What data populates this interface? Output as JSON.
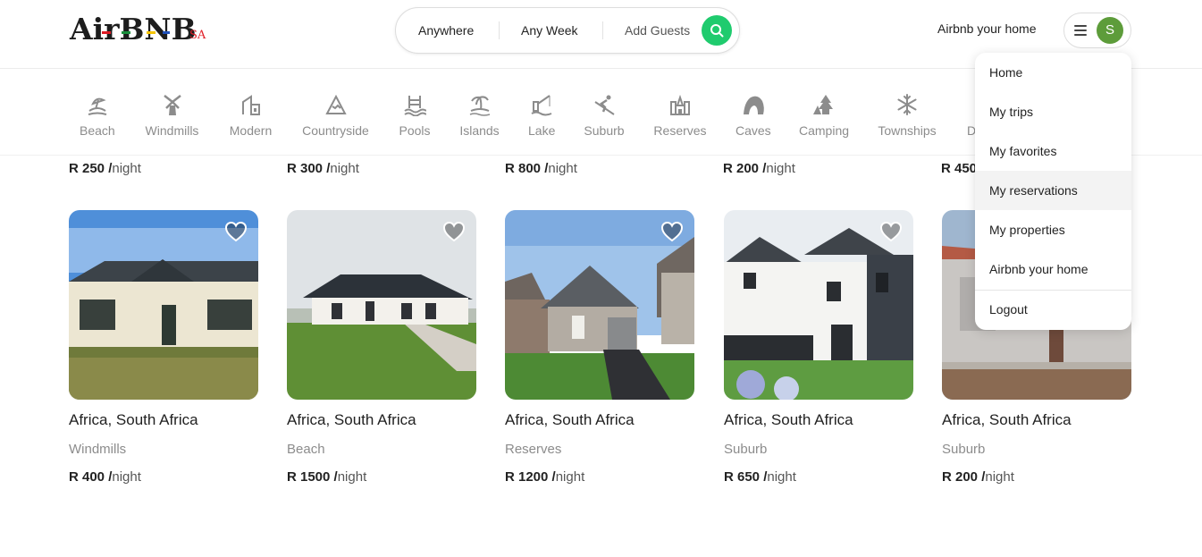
{
  "brand": {
    "name": "AirBNB",
    "suffix": "SA"
  },
  "search": {
    "anywhere": "Anywhere",
    "week": "Any Week",
    "guests": "Add Guests",
    "accent": "#1fcb6e"
  },
  "header": {
    "host_link": "Airbnb your home",
    "avatar_initial": "S",
    "avatar_color": "#5d9c3a"
  },
  "categories": [
    {
      "label": "Beach",
      "icon": "beach-icon"
    },
    {
      "label": "Windmills",
      "icon": "windmill-icon"
    },
    {
      "label": "Modern",
      "icon": "modern-icon"
    },
    {
      "label": "Countryside",
      "icon": "mountain-icon"
    },
    {
      "label": "Pools",
      "icon": "pool-icon"
    },
    {
      "label": "Islands",
      "icon": "island-icon"
    },
    {
      "label": "Lake",
      "icon": "fishing-icon"
    },
    {
      "label": "Suburb",
      "icon": "skiing-icon"
    },
    {
      "label": "Reserves",
      "icon": "castle-icon"
    },
    {
      "label": "Caves",
      "icon": "cave-icon"
    },
    {
      "label": "Camping",
      "icon": "forest-icon"
    },
    {
      "label": "Townships",
      "icon": "snowflake-icon"
    },
    {
      "label": "D",
      "icon": ""
    }
  ],
  "previous_prices": [
    {
      "amount": "R 250 /",
      "unit": "night"
    },
    {
      "amount": "R 300 /",
      "unit": "night"
    },
    {
      "amount": "R 800 /",
      "unit": "night"
    },
    {
      "amount": "R 200 /",
      "unit": "night"
    },
    {
      "amount": "R 450",
      "unit": ""
    }
  ],
  "listings": [
    {
      "location": "Africa, South Africa",
      "category": "Windmills",
      "price": "R 400 /",
      "unit": "night"
    },
    {
      "location": "Africa, South Africa",
      "category": "Beach",
      "price": "R 1500 /",
      "unit": "night"
    },
    {
      "location": "Africa, South Africa",
      "category": "Reserves",
      "price": "R 1200 /",
      "unit": "night"
    },
    {
      "location": "Africa, South Africa",
      "category": "Suburb",
      "price": "R 650 /",
      "unit": "night"
    },
    {
      "location": "Africa, South Africa",
      "category": "Suburb",
      "price": "R 200 /",
      "unit": "night"
    }
  ],
  "menu": {
    "items": [
      "Home",
      "My trips",
      "My favorites",
      "My reservations",
      "My properties",
      "Airbnb your home",
      "Logout"
    ],
    "highlighted": "My reservations"
  }
}
